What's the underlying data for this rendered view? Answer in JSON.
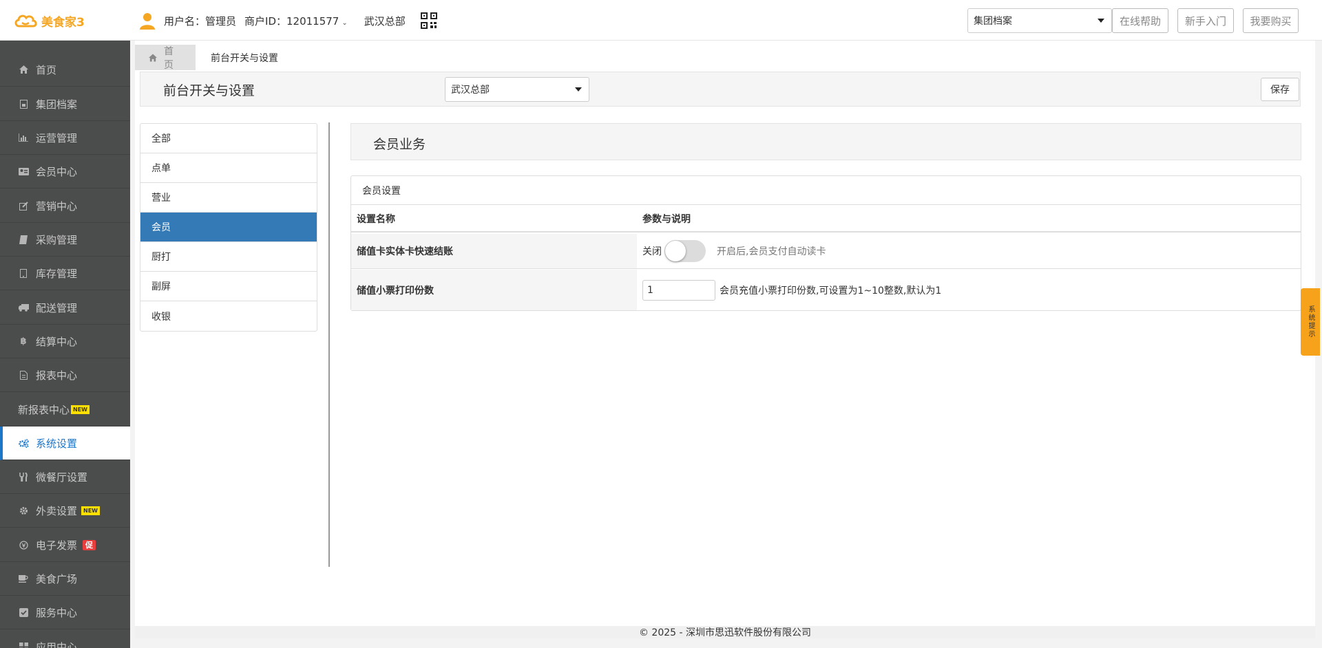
{
  "header": {
    "logo_text": "美食家3",
    "username": "用户名：管理员",
    "merchant_id": "商户ID：12011577",
    "store": "武汉总部",
    "select_value": "集团档案",
    "buttons": [
      "在线帮助",
      "新手入门",
      "我要购买"
    ]
  },
  "sidebar": {
    "items": [
      {
        "label": "首页",
        "icon": "home-icon"
      },
      {
        "label": "集团档案",
        "icon": "archive-icon"
      },
      {
        "label": "运营管理",
        "icon": "bar-chart-icon"
      },
      {
        "label": "会员中心",
        "icon": "member-card-icon"
      },
      {
        "label": "营销中心",
        "icon": "edit-icon"
      },
      {
        "label": "采购管理",
        "icon": "book-icon"
      },
      {
        "label": "库存管理",
        "icon": "inventory-icon"
      },
      {
        "label": "配送管理",
        "icon": "truck-icon"
      },
      {
        "label": "结算中心",
        "icon": "bitcoin-icon"
      },
      {
        "label": "报表中心",
        "icon": "report-icon"
      },
      {
        "label": "新报表中心",
        "badge": "NEW"
      },
      {
        "label": "系统设置",
        "icon": "gears-icon"
      },
      {
        "label": "微餐厅设置",
        "icon": "cutlery-icon"
      },
      {
        "label": "外卖设置",
        "icon": "gear-icon",
        "badge": "NEW"
      },
      {
        "label": "电子发票",
        "icon": "invoice-icon",
        "badge": "促"
      },
      {
        "label": "美食广场",
        "icon": "coffee-icon"
      },
      {
        "label": "服务中心",
        "icon": "check-square-icon"
      },
      {
        "label": "应用中心",
        "icon": "app-icon"
      }
    ]
  },
  "tabs": [
    {
      "label": "首页"
    },
    {
      "label": "前台开关与设置"
    }
  ],
  "page": {
    "title": "前台开关与设置",
    "store_select": "武汉总部",
    "save_label": "保存"
  },
  "categories": [
    "全部",
    "点单",
    "营业",
    "会员",
    "厨打",
    "副屏",
    "收银"
  ],
  "section": {
    "title": "会员业务",
    "panel_title": "会员设置",
    "headers": [
      "设置名称",
      "参数与说明"
    ],
    "rows": [
      {
        "name": "储值卡实体卡快速结账",
        "toggle_label": "关闭",
        "desc": "开启后,会员支付自动读卡"
      },
      {
        "name": "储值小票打印份数",
        "input_value": "1",
        "desc": "会员充值小票打印份数,可设置为1~10整数,默认为1"
      }
    ]
  },
  "footer": "© 2025 - 深圳市思迅软件股份有限公司",
  "side_tip": "系统提示",
  "colors": {
    "accent": "#337ab7",
    "sidebar_bg": "#4b4c4c",
    "logo": "#f5a623",
    "tip": "#f7a21b"
  }
}
